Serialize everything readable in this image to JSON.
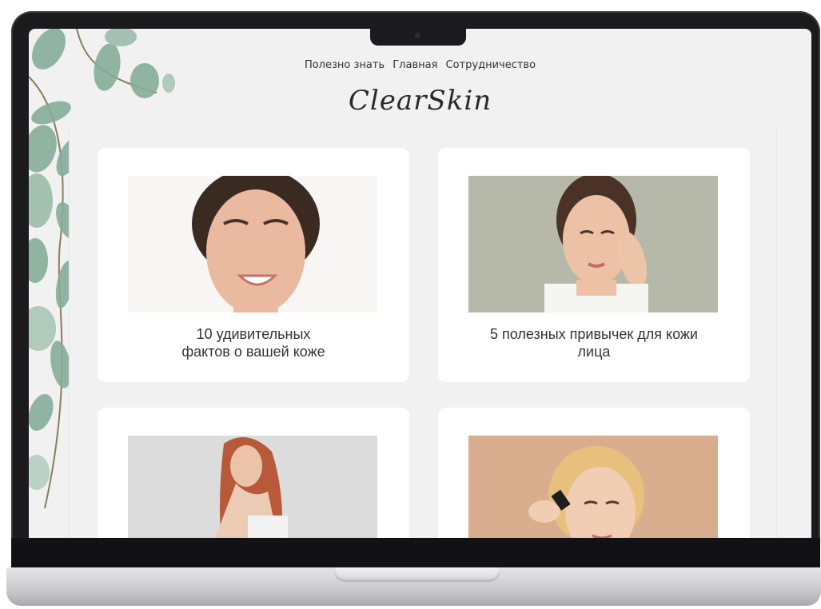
{
  "nav": {
    "items": [
      "Полезно знать",
      "Главная",
      "Сотрудничество"
    ]
  },
  "logo": {
    "text": "ClearSkin"
  },
  "cards": [
    {
      "title_line1": "10 удивительных",
      "title_line2": "фактов о вашей коже",
      "image": "smiling-freckled-woman"
    },
    {
      "title_line1": "5 полезных привычек для кожи",
      "title_line2": "лица",
      "image": "woman-hands-on-cheek"
    },
    {
      "title_line1": "",
      "title_line2": "",
      "image": "redhead-woman-looking-back"
    },
    {
      "title_line1": "",
      "title_line2": "",
      "image": "blonde-woman-with-dropper"
    }
  ],
  "colors": {
    "screen_bg": "#f1f1f1",
    "card_bg": "#ffffff",
    "leaf": "#7fa592"
  }
}
